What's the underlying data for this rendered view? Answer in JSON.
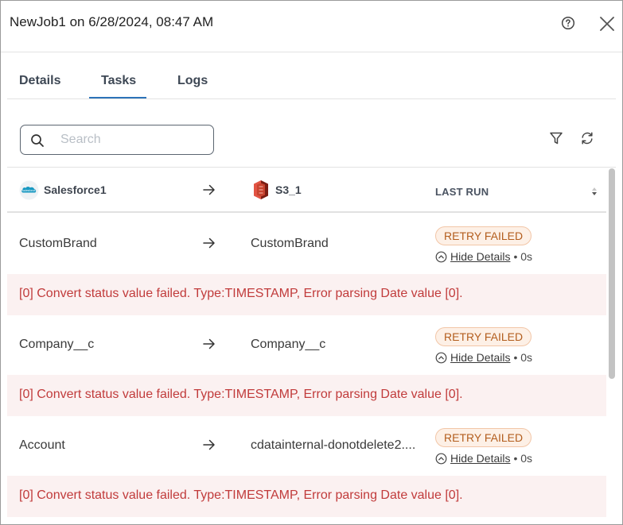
{
  "header": {
    "title": "NewJob1 on 6/28/2024, 08:47 AM"
  },
  "icons": {
    "help": "question-circle-icon",
    "close": "close-icon",
    "search": "search-icon",
    "filter": "filter-icon",
    "refresh": "refresh-icon",
    "arrow": "arrow-right-icon",
    "sort": "sort-icon",
    "chevron": "chevron-up-circle-icon"
  },
  "tabs": [
    {
      "label": "Details",
      "active": false
    },
    {
      "label": "Tasks",
      "active": true
    },
    {
      "label": "Logs",
      "active": false
    }
  ],
  "search": {
    "placeholder": "Search",
    "value": ""
  },
  "table": {
    "source_name": "Salesforce1",
    "source_logo_text": "salesforce",
    "destination_name": "S3_1",
    "last_run_header": "LAST RUN",
    "rows": [
      {
        "source": "CustomBrand",
        "destination": "CustomBrand",
        "status": "RETRY FAILED",
        "hide_label": "Hide Details",
        "duration": "• 0s",
        "error": "[0] Convert status value failed. Type:TIMESTAMP, Error parsing Date value [0]."
      },
      {
        "source": "Company__c",
        "destination": "Company__c",
        "status": "RETRY FAILED",
        "hide_label": "Hide Details",
        "duration": "• 0s",
        "error": "[0] Convert status value failed. Type:TIMESTAMP, Error parsing Date value [0]."
      },
      {
        "source": "Account",
        "destination": "cdatainternal-donotdelete2....",
        "status": "RETRY FAILED",
        "hide_label": "Hide Details",
        "duration": "• 0s",
        "error": "[0] Convert status value failed. Type:TIMESTAMP, Error parsing Date value [0]."
      }
    ]
  },
  "colors": {
    "accent": "#2c73b8",
    "status_badge_bg": "#fdf0e6",
    "status_badge_text": "#b35d1d",
    "error_bg": "#fbf1f1",
    "error_text": "#c13b3b",
    "salesforce_blue": "#1798c1",
    "s3_red": "#c7432f"
  }
}
